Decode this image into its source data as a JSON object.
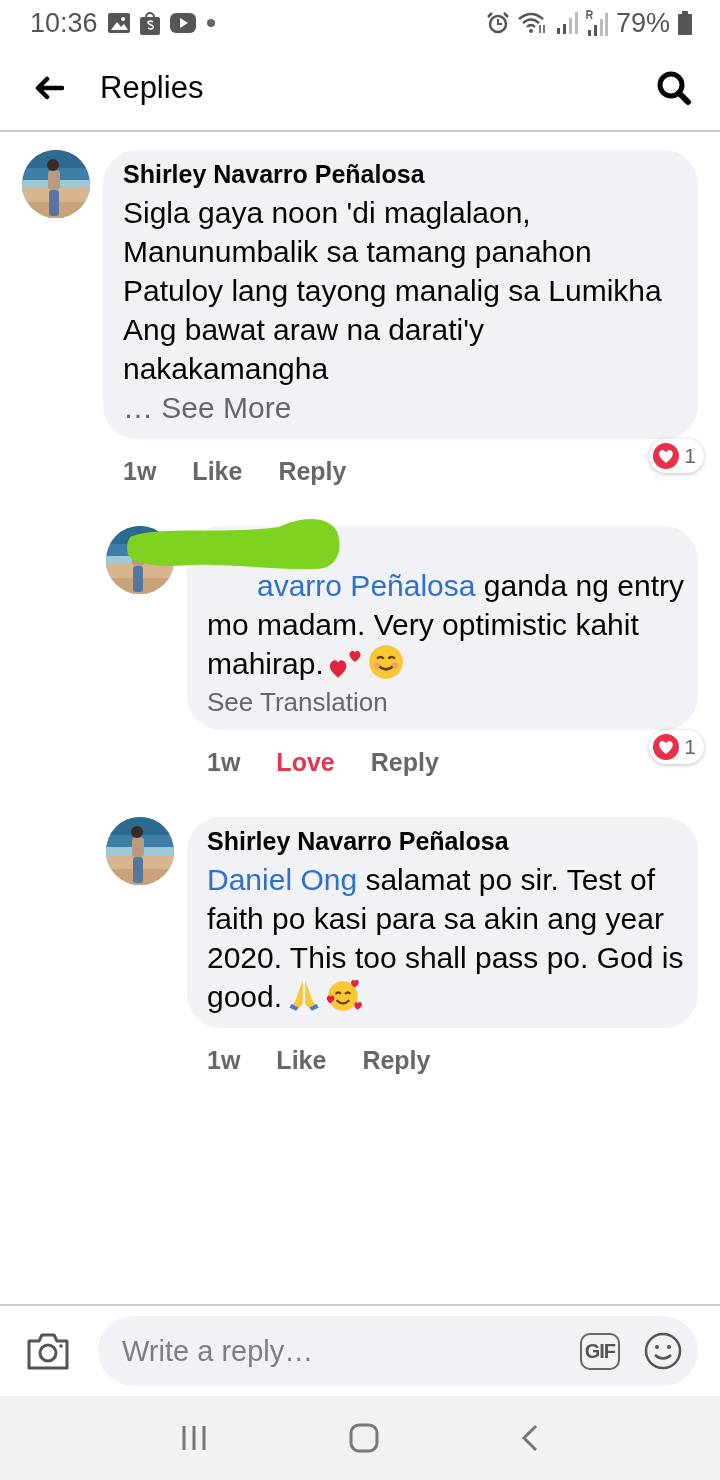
{
  "status_bar": {
    "time": "10:36",
    "battery": "79%"
  },
  "header": {
    "title": "Replies"
  },
  "comments": [
    {
      "author": "Shirley Navarro Peñalosa",
      "author_hidden": false,
      "lines": [
        "Sigla gaya noon 'di maglalaon,",
        "Manunumbalik sa tamang panahon",
        "Patuloy lang tayong manalig sa Lumikha",
        "Ang bawat araw na darati'y nakakamangha"
      ],
      "see_more": "… See More",
      "time": "1w",
      "like": "Like",
      "reacted": false,
      "reply": "Reply",
      "reaction_count": "1",
      "replies": [
        {
          "author_hidden": true,
          "mention": "avarro Peñalosa",
          "text": "ganda ng entry mo madam. Very optimistic kahit mahirap.",
          "emojis": [
            {
              "kind": "hearts"
            },
            {
              "kind": "smile"
            }
          ],
          "translation": "See Translation",
          "time": "1w",
          "like": "Love",
          "reacted": true,
          "reply": "Reply",
          "reaction_count": "1"
        },
        {
          "author": "Shirley Navarro Peñalosa",
          "author_hidden": false,
          "mention": "Daniel Ong",
          "text": "salamat po sir. Test of faith po kasi para sa akin ang year 2020. This too shall pass po. God is good.",
          "emojis": [
            {
              "kind": "pray"
            },
            {
              "kind": "heart-face"
            }
          ],
          "time": "1w",
          "like": "Like",
          "reacted": false,
          "reply": "Reply"
        }
      ]
    }
  ],
  "composer": {
    "placeholder": "Write a reply…",
    "gif": "GIF"
  }
}
